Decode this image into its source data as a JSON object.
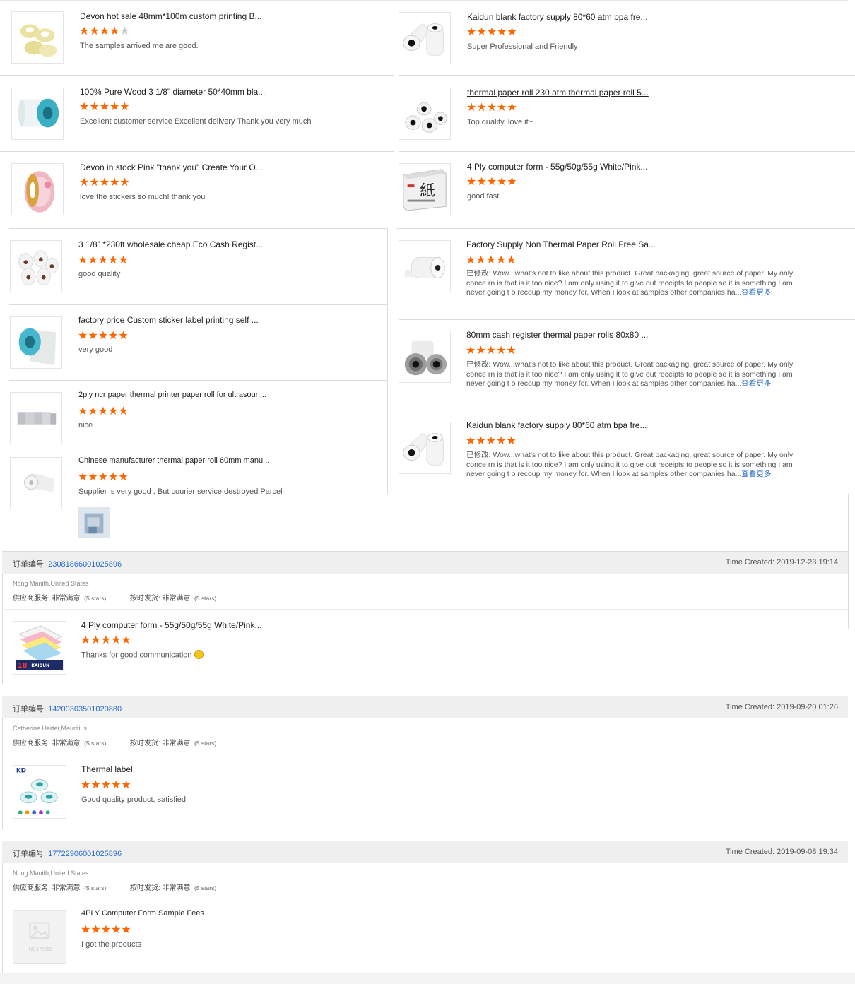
{
  "top_reviews": {
    "left": [
      {
        "title": "Devon hot sale 48mm*100m custom printing B...",
        "stars": 4,
        "comment": "The samples arrived me are good.",
        "img": "tape-icon"
      },
      {
        "title": "100% Pure Wood 3 1/8\" diameter 50*40mm bla...",
        "stars": 5,
        "comment": "Excellent customer service Excellent delivery Thank you very much",
        "img": "label-roll-icon"
      },
      {
        "title": "Devon in stock Pink \"thank you\" Create Your O...",
        "stars": 5,
        "comment": "love the stickers so much! thank you",
        "img": "pink-sticker-roll-icon"
      },
      {
        "title": "3 1/8\" *230ft wholesale cheap Eco Cash Regist...",
        "stars": 5,
        "comment": "good quality",
        "img": "paper-rolls-icon"
      },
      {
        "title": "factory price Custom sticker label printing self ...",
        "stars": 5,
        "comment": "very good",
        "img": "label-roll-icon"
      },
      {
        "title": "2ply ncr paper thermal printer paper roll for ultrasoun...",
        "stars": 5,
        "comment": "nice",
        "img": "small-rolls-icon"
      },
      {
        "title": "Chinese manufacturer thermal paper roll 60mm manu...",
        "stars": 5,
        "comment": "Supplier is very good , But courier service destroyed Parcel",
        "img": "single-roll-icon"
      }
    ],
    "right": [
      {
        "title": "Kaidun blank factory supply 80*60 atm bpa fre...",
        "stars": 5,
        "comment": "Super Professional and Friendly",
        "img": "two-rolls-icon"
      },
      {
        "title": "thermal paper roll 230 atm thermal paper roll 5...",
        "stars": 5,
        "comment": "Top quality, love it~",
        "img": "paper-rolls-icon"
      },
      {
        "title": "4 Ply computer form - 55g/50g/55g White/Pink...",
        "stars": 5,
        "comment": "good fast",
        "img": "paper-box-icon"
      },
      {
        "title": "Factory Supply Non Thermal Paper Roll Free Sa...",
        "stars": 5,
        "comment": "已修改: Wow...what's not to like about this product.  Great packaging, great source of paper.  My only conce rn is that is it too nice?  I am only using it to give out receipts to people so it is something I am never going t o recoup my money for.  When I look at samples other companies ha...",
        "more": "查看更多",
        "img": "single-roll-icon"
      },
      {
        "title": "80mm cash register thermal paper rolls 80x80 ...",
        "stars": 5,
        "comment": "已修改: Wow...what's not to like about this product.  Great packaging, great source of paper.  My only conce rn is that is it too nice?  I am only using it to give out receipts to people so it is something I am never going t o recoup my money for.  When I look at samples other companies ha...",
        "more": "查看更多",
        "img": "gray-rolls-icon"
      },
      {
        "title": "Kaidun blank factory supply 80*60 atm bpa fre...",
        "stars": 5,
        "comment": "已修改: Wow...what's not to like about this product.  Great packaging, great source of paper.  My only conce rn is that is it too nice?  I am only using it to give out receipts to people so it is something I am never going t o recoup my money for.  When I look at samples other companies ha...",
        "more": "查看更多",
        "img": "two-rolls-icon"
      }
    ]
  },
  "orders": [
    {
      "order_label": "订单编号: ",
      "order_no": "23081866001025896",
      "time_created": "Time Created: 2019-12-23 19:14",
      "buyer": "Nong Manith,United States",
      "supplier_service_label": "供应商服务: ",
      "supplier_service_value": "非常满意",
      "supplier_service_stars": "(5 stars)",
      "ontime_label": "按时发货: ",
      "ontime_value": "非常满意",
      "ontime_stars": "(5 stars)",
      "product_title": "4 Ply computer form - 55g/50g/55g White/Pink...",
      "stars": 5,
      "comment": "Thanks for good communication",
      "img": "computer-form-icon"
    },
    {
      "order_label": "订单编号: ",
      "order_no": "14200303501020880",
      "time_created": "Time Created: 2019-09-20 01:26",
      "buyer": "Catherine Harter,Mauritius",
      "supplier_service_label": "供应商服务: ",
      "supplier_service_value": "非常满意",
      "supplier_service_stars": "(5 stars)",
      "ontime_label": "按时发货: ",
      "ontime_value": "非常满意",
      "ontime_stars": "(5 stars)",
      "product_title": "Thermal label",
      "stars": 5,
      "comment": "Good quality product, satisfied.",
      "img": "label-rolls-icon"
    },
    {
      "order_label": "订单编号: ",
      "order_no": "17722906001025896",
      "time_created": "Time Created: 2019-09-08 19:34",
      "buyer": "Nong Manith,United States",
      "supplier_service_label": "供应商服务: ",
      "supplier_service_value": "非常满意",
      "supplier_service_stars": "(5 stars)",
      "ontime_label": "按时发货: ",
      "ontime_value": "非常满意",
      "ontime_stars": "(5 stars)",
      "product_title": "4PLY Computer Form Sample Fees",
      "stars": 5,
      "comment": "I got the products",
      "img": "no-photo-icon",
      "no_photo_text": "No Photo"
    }
  ],
  "colors": {
    "star": "#ff6a00",
    "link": "#2a6ecb",
    "header_bg": "#efefef"
  }
}
